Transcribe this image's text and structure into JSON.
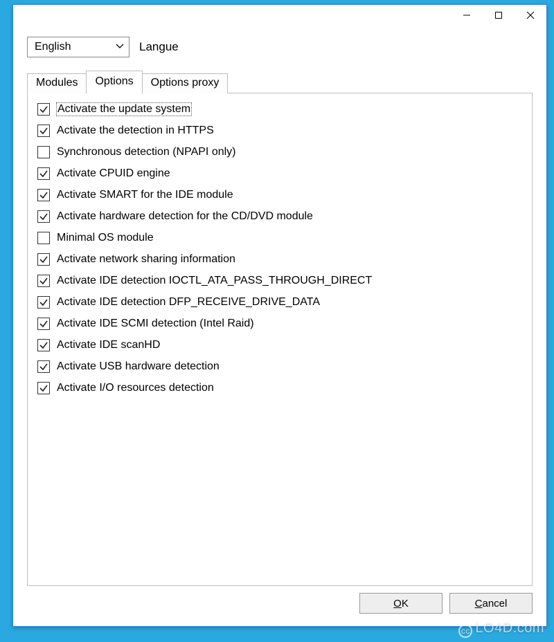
{
  "language": {
    "selected": "English",
    "label": "Langue"
  },
  "tabs": [
    "Modules",
    "Options",
    "Options proxy"
  ],
  "activeTab": 1,
  "options": [
    {
      "checked": true,
      "label": "Activate the update system",
      "focused": true
    },
    {
      "checked": true,
      "label": "Activate the detection in HTTPS"
    },
    {
      "checked": false,
      "label": "Synchronous detection (NPAPI only)"
    },
    {
      "checked": true,
      "label": "Activate CPUID engine"
    },
    {
      "checked": true,
      "label": "Activate SMART for the IDE module"
    },
    {
      "checked": true,
      "label": "Activate hardware detection for the CD/DVD module"
    },
    {
      "checked": false,
      "label": "Minimal OS module"
    },
    {
      "checked": true,
      "label": "Activate network sharing information"
    },
    {
      "checked": true,
      "label": "Activate IDE detection IOCTL_ATA_PASS_THROUGH_DIRECT"
    },
    {
      "checked": true,
      "label": "Activate IDE detection DFP_RECEIVE_DRIVE_DATA"
    },
    {
      "checked": true,
      "label": "Activate IDE SCMI detection (Intel Raid)"
    },
    {
      "checked": true,
      "label": "Activate IDE scanHD"
    },
    {
      "checked": true,
      "label": "Activate USB hardware detection"
    },
    {
      "checked": true,
      "label": "Activate I/O resources detection"
    }
  ],
  "buttons": {
    "ok": "OK",
    "cancel": "Cancel"
  },
  "watermark": "LO4D.com"
}
